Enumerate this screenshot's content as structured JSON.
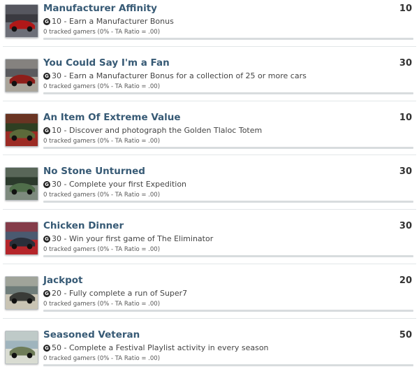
{
  "achievements": [
    {
      "title": "Manufacturer Affinity",
      "points": "10",
      "gamerscore": "10",
      "description": "Earn a Manufacturer Bonus",
      "tracked": "0 tracked gamers (0% - TA Ratio = .00)",
      "progress": 0,
      "thumb_icon": "red-car-thumbnail",
      "colors": [
        "#3a3a40",
        "#b01818",
        "#6d6f78"
      ]
    },
    {
      "title": "You Could Say I'm a Fan",
      "points": "30",
      "gamerscore": "30",
      "description": "Earn a Manufacturer Bonus for a collection of 25 or more cars",
      "tracked": "0 tracked gamers (0% - TA Ratio = .00)",
      "progress": 0,
      "thumb_icon": "car-in-garage-thumbnail",
      "colors": [
        "#5a5a5e",
        "#8e1e1a",
        "#a9a49a"
      ]
    },
    {
      "title": "An Item Of Extreme Value",
      "points": "10",
      "gamerscore": "10",
      "description": "Discover and photograph the Golden Tlaloc Totem",
      "tracked": "0 tracked gamers (0% - TA Ratio = .00)",
      "progress": 0,
      "thumb_icon": "jungle-scene-thumbnail",
      "colors": [
        "#2e3f22",
        "#5c6a3a",
        "#9c2b24"
      ]
    },
    {
      "title": "No Stone Unturned",
      "points": "30",
      "gamerscore": "30",
      "description": "Complete your first Expedition",
      "tracked": "0 tracked gamers (0% - TA Ratio = .00)",
      "progress": 0,
      "thumb_icon": "forest-road-thumbnail",
      "colors": [
        "#2b3a2c",
        "#4f6e4a",
        "#7d8a7e"
      ]
    },
    {
      "title": "Chicken Dinner",
      "points": "30",
      "gamerscore": "30",
      "description": "Win your first game of The Eliminator",
      "tracked": "0 tracked gamers (0% - TA Ratio = .00)",
      "progress": 0,
      "thumb_icon": "sports-car-thumbnail",
      "colors": [
        "#4a5a70",
        "#2a2f3a",
        "#b5252a"
      ]
    },
    {
      "title": "Jackpot",
      "points": "20",
      "gamerscore": "20",
      "description": "Fully complete a run of Super7",
      "tracked": "0 tracked gamers (0% - TA Ratio = .00)",
      "progress": 0,
      "thumb_icon": "jumping-car-thumbnail",
      "colors": [
        "#6f7d7a",
        "#3a3c38",
        "#c9c4b4"
      ]
    },
    {
      "title": "Seasoned Veteran",
      "points": "50",
      "gamerscore": "50",
      "description": "Complete a Festival Playlist activity in every season",
      "tracked": "0 tracked gamers (0% - TA Ratio = .00)",
      "progress": 0,
      "thumb_icon": "classic-car-thumbnail",
      "colors": [
        "#9fb4bd",
        "#6e7c58",
        "#d9dcd2"
      ]
    }
  ]
}
